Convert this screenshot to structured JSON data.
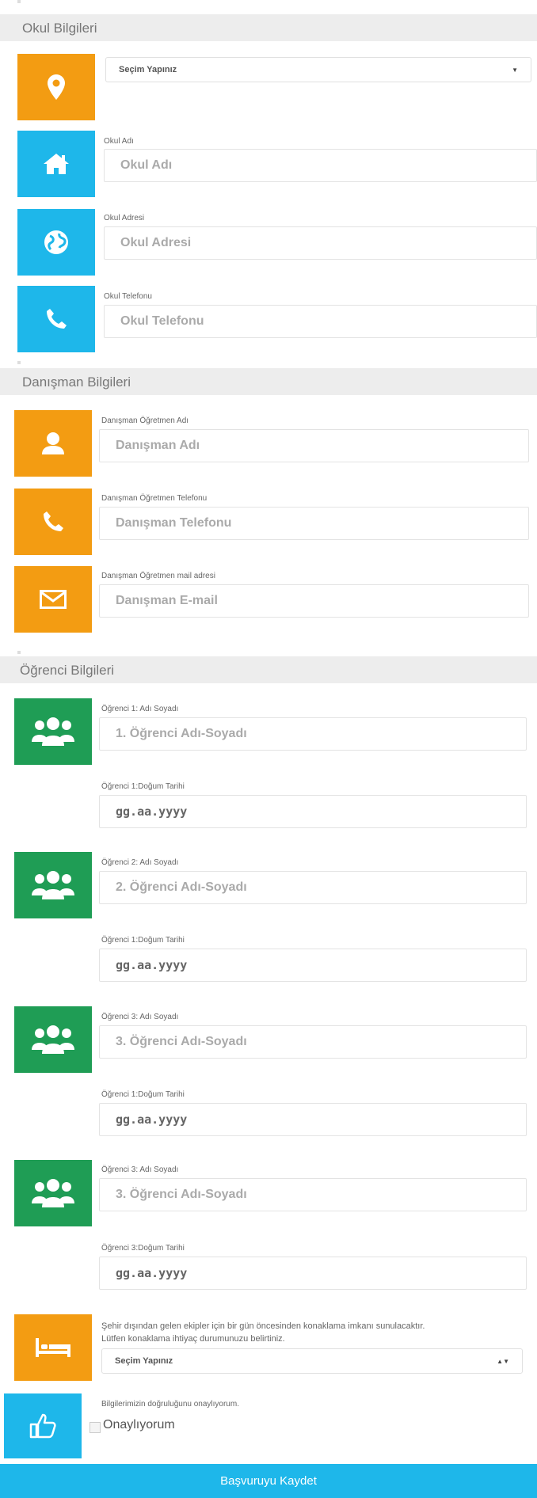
{
  "school": {
    "section_title": "Okul Bilgileri",
    "select_value": "Seçim Yapınız",
    "name_label": "Okul Adı",
    "name_placeholder": "Okul Adı",
    "address_label": "Okul Adresi",
    "address_placeholder": "Okul Adresi",
    "phone_label": "Okul Telefonu",
    "phone_placeholder": "Okul Telefonu"
  },
  "advisor": {
    "section_title": "Danışman Bilgileri",
    "name_label": "Danışman Öğretmen Adı",
    "name_placeholder": "Danışman Adı",
    "phone_label": "Danışman Öğretmen Telefonu",
    "phone_placeholder": "Danışman Telefonu",
    "email_label": "Danışman Öğretmen mail adresi",
    "email_placeholder": "Danışman E-mail"
  },
  "students": {
    "section_title": "Öğrenci Bilgileri",
    "items": [
      {
        "name_label": "Öğrenci 1: Adı Soyadı",
        "name_placeholder": "1. Öğrenci Adı-Soyadı",
        "dob_label": "Öğrenci 1:Doğum Tarihi",
        "dob_placeholder": "gg.aa.yyyy"
      },
      {
        "name_label": "Öğrenci 2: Adı Soyadı",
        "name_placeholder": "2. Öğrenci Adı-Soyadı",
        "dob_label": "Öğrenci 1:Doğum Tarihi",
        "dob_placeholder": "gg.aa.yyyy"
      },
      {
        "name_label": "Öğrenci 3: Adı Soyadı",
        "name_placeholder": "3. Öğrenci Adı-Soyadı",
        "dob_label": "Öğrenci 1:Doğum Tarihi",
        "dob_placeholder": "gg.aa.yyyy"
      },
      {
        "name_label": "Öğrenci 3: Adı Soyadı",
        "name_placeholder": "3. Öğrenci Adı-Soyadı",
        "dob_label": "Öğrenci 3:Doğum Tarihi",
        "dob_placeholder": "gg.aa.yyyy"
      }
    ]
  },
  "accommodation": {
    "note_line1": "Şehir dışından gelen ekipler için bir gün öncesinden konaklama imkanı sunulacaktır.",
    "note_line2": "Lütfen konaklama ihtiyaç durumunuzu belirtiniz.",
    "select_value": "Seçim Yapınız"
  },
  "confirm": {
    "note": "Bilgilerimizin doğruluğunu onaylıyorum.",
    "checkbox_label": "Onaylıyorum"
  },
  "submit_label": "Başvuruyu Kaydet",
  "colors": {
    "orange": "#f39c12",
    "blue": "#1eb7ea",
    "green": "#1f9d55"
  },
  "icons": [
    "map-marker-icon",
    "home-icon",
    "globe-icon",
    "phone-icon",
    "user-icon",
    "envelope-icon",
    "users-icon",
    "bed-icon",
    "thumbs-up-icon"
  ]
}
